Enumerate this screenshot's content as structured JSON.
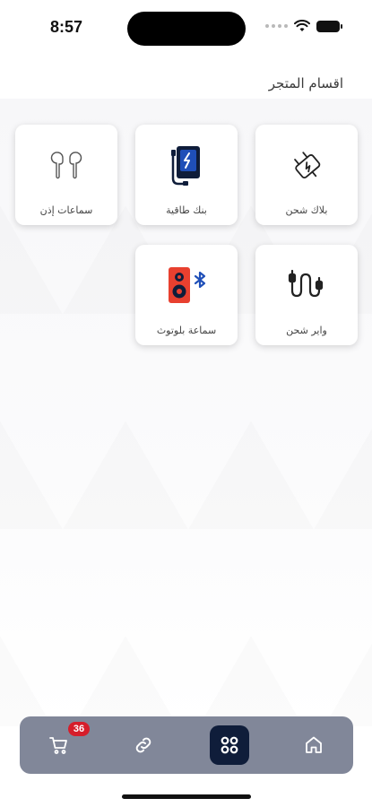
{
  "status_bar": {
    "time": "8:57"
  },
  "page": {
    "title": "اقسام المتجر"
  },
  "categories": [
    {
      "label": "بلاك شحن",
      "icon": "charger-plug-icon"
    },
    {
      "label": "بنك طاقية",
      "icon": "power-bank-icon"
    },
    {
      "label": "سماعات إذن",
      "icon": "earbuds-icon"
    },
    {
      "label": "واير شحن",
      "icon": "cable-icon"
    },
    {
      "label": "سماعة بلوتوث",
      "icon": "bluetooth-speaker-icon"
    }
  ],
  "bottom_nav": {
    "cart_badge": "36",
    "items": [
      "cart-icon",
      "link-icon",
      "categories-icon",
      "home-icon"
    ],
    "active": "categories-icon"
  },
  "colors": {
    "nav_bg": "#818799",
    "active_bg": "#0f1d3a",
    "badge": "#d61e2b",
    "accent_blue": "#1f4fb8",
    "accent_red": "#e8402f"
  }
}
